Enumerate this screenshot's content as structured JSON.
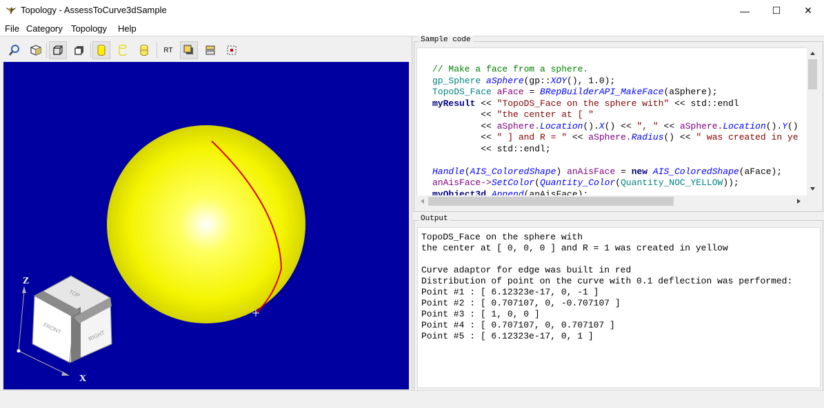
{
  "window": {
    "title": "Topology - AssessToCurve3dSample",
    "controls": {
      "minimize": "—",
      "maximize": "☐",
      "close": "✕"
    }
  },
  "menu": [
    "File",
    "Category",
    "Topology",
    "Help"
  ],
  "toolbar": {
    "buttons": [
      {
        "icon": "fit-all-icon"
      },
      {
        "icon": "axonometric-icon"
      },
      {
        "icon": "wireframe-icon"
      },
      {
        "icon": "shading-icon"
      },
      {
        "icon": "cylinder-shaded-icon"
      },
      {
        "icon": "cylinder-hlr-icon"
      },
      {
        "icon": "cylinder-wire-icon"
      },
      {
        "icon": "raytrace-icon",
        "label": "RT"
      },
      {
        "icon": "shadows-icon"
      },
      {
        "icon": "reflections-icon"
      },
      {
        "icon": "antialiasing-icon"
      }
    ]
  },
  "viewer": {
    "background": "#0000a0",
    "sphere_color": "#ffff00",
    "curve_color": "#e00000",
    "view_cube": {
      "top": "TOP",
      "front": "FRONT",
      "right": "RIGHT"
    },
    "axes": {
      "z": "Z",
      "x": "X"
    }
  },
  "sample_code": {
    "title": "Sample code",
    "lines": [
      [
        {
          "t": "// Make a face from a sphere.",
          "c": "com"
        }
      ],
      [
        {
          "t": "gp_Sphere ",
          "c": "type"
        },
        {
          "t": "aSphere",
          "c": "fn"
        },
        {
          "t": "(gp::",
          "c": "plain"
        },
        {
          "t": "XOY",
          "c": "fn"
        },
        {
          "t": "(), 1.0);",
          "c": "plain"
        }
      ],
      [
        {
          "t": "TopoDS_Face ",
          "c": "type"
        },
        {
          "t": "aFace",
          "c": "var"
        },
        {
          "t": " = ",
          "c": "plain"
        },
        {
          "t": "BRepBuilderAPI_MakeFace",
          "c": "fn"
        },
        {
          "t": "(aSphere);",
          "c": "plain"
        }
      ],
      [
        {
          "t": "myResult",
          "c": "kw"
        },
        {
          "t": " << ",
          "c": "plain"
        },
        {
          "t": "\"TopoDS_Face on the sphere with\"",
          "c": "str"
        },
        {
          "t": " << std::endl",
          "c": "plain"
        }
      ],
      [
        {
          "t": "         << ",
          "c": "plain"
        },
        {
          "t": "\"the center at [ \"",
          "c": "str"
        }
      ],
      [
        {
          "t": "         << ",
          "c": "plain"
        },
        {
          "t": "aSphere.",
          "c": "var"
        },
        {
          "t": "Location",
          "c": "fn"
        },
        {
          "t": "().",
          "c": "plain"
        },
        {
          "t": "X",
          "c": "fn"
        },
        {
          "t": "() << ",
          "c": "plain"
        },
        {
          "t": "\", \"",
          "c": "str"
        },
        {
          "t": " << ",
          "c": "plain"
        },
        {
          "t": "aSphere.",
          "c": "var"
        },
        {
          "t": "Location",
          "c": "fn"
        },
        {
          "t": "().",
          "c": "plain"
        },
        {
          "t": "Y",
          "c": "fn"
        },
        {
          "t": "()",
          "c": "plain"
        }
      ],
      [
        {
          "t": "         << ",
          "c": "plain"
        },
        {
          "t": "\" ] and R = \"",
          "c": "str"
        },
        {
          "t": " << ",
          "c": "plain"
        },
        {
          "t": "aSphere.",
          "c": "var"
        },
        {
          "t": "Radius",
          "c": "fn"
        },
        {
          "t": "() << ",
          "c": "plain"
        },
        {
          "t": "\" was created in ye",
          "c": "str"
        }
      ],
      [
        {
          "t": "         << std::endl;",
          "c": "plain"
        }
      ],
      [
        {
          "t": "",
          "c": "plain"
        }
      ],
      [
        {
          "t": "Handle",
          "c": "fn"
        },
        {
          "t": "(",
          "c": "plain"
        },
        {
          "t": "AIS_ColoredShape",
          "c": "fn"
        },
        {
          "t": ") ",
          "c": "plain"
        },
        {
          "t": "anAisFace",
          "c": "var"
        },
        {
          "t": " = ",
          "c": "plain"
        },
        {
          "t": "new ",
          "c": "kw"
        },
        {
          "t": "AIS_ColoredShape",
          "c": "fn"
        },
        {
          "t": "(aFace);",
          "c": "plain"
        }
      ],
      [
        {
          "t": "anAisFace->",
          "c": "var"
        },
        {
          "t": "SetColor",
          "c": "fn"
        },
        {
          "t": "(",
          "c": "plain"
        },
        {
          "t": "Quantity_Color",
          "c": "fn"
        },
        {
          "t": "(",
          "c": "plain"
        },
        {
          "t": "Quantity_NOC_YELLOW",
          "c": "type"
        },
        {
          "t": "));",
          "c": "plain"
        }
      ],
      [
        {
          "t": "myObject3d.",
          "c": "kw"
        },
        {
          "t": "Append",
          "c": "fn"
        },
        {
          "t": "(anAisFace);",
          "c": "plain"
        }
      ]
    ]
  },
  "output": {
    "title": "Output",
    "lines": [
      "TopoDS_Face on the sphere with",
      "the center at [ 0, 0, 0 ] and R = 1 was created in yellow",
      "",
      "Curve adaptor for edge was built in red",
      "Distribution of point on the curve with 0.1 deflection was performed:",
      "Point #1 : [ 6.12323e-17, 0, -1 ]",
      "Point #2 : [ 0.707107, 0, -0.707107 ]",
      "Point #3 : [ 1, 0, 0 ]",
      "Point #4 : [ 0.707107, 0, 0.707107 ]",
      "Point #5 : [ 6.12323e-17, 0, 1 ]"
    ]
  }
}
